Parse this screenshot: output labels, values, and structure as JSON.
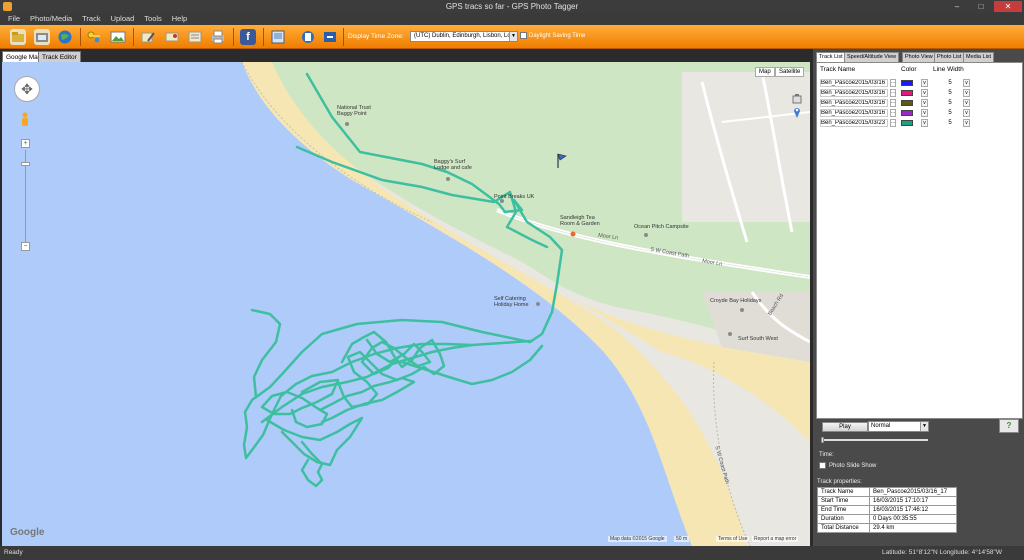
{
  "window": {
    "title": "GPS tracs so far - GPS Photo Tagger",
    "minimize_glyph": "–",
    "maximize_glyph": "□",
    "close_glyph": "✕"
  },
  "menu": [
    "File",
    "Photo/Media",
    "Track",
    "Upload",
    "Tools",
    "Help"
  ],
  "toolbar": {
    "icons": [
      "open-folder-icon",
      "import-photos-icon",
      "globe-icon",
      "key-icon",
      "photo-icon",
      "edit-icon",
      "tag-icon",
      "export-icon",
      "print-icon",
      "facebook-icon",
      "album-icon",
      "phone-icon",
      "sync-icon"
    ],
    "facebook_glyph": "f",
    "time_zone_label": "Display Time Zone:",
    "time_zone_value": "(UTC) Dublin, Edinburgh, Lisbon, Lon",
    "dst_label": "Daylight Saving Time"
  },
  "tabs": {
    "google_map": "Google Map",
    "track_editor": "Track Editor"
  },
  "map": {
    "type_map": "Map",
    "type_satellite": "Satellite",
    "zoom_in": "+",
    "zoom_out": "−",
    "pan_glyph": "✥",
    "places": {
      "national_trust": "National Trust\nBaggy Point",
      "baggys": "Baggy's Surf\nLodge and cafe",
      "point_breaks": "Point Breaks UK",
      "sandleigh": "Sandleigh Tea\nRoom & Garden",
      "ocean_pitch": "Ocean Pitch Campsite",
      "self_catering": "Self Catering\nHoliday Home",
      "croyde_bay": "Croyde Bay Holidays",
      "surf_south_west": "Surf South West"
    },
    "roads": {
      "moor_ln_1": "Moor Ln",
      "sw_coast_path_1": "S W Coast Path",
      "moor_ln_2": "Moor Ln",
      "sw_coast_path_2": "S W Coast Path",
      "beach_rd": "Beach Rd"
    },
    "google_logo": "Google",
    "attribution": "Map data ©2015 Google",
    "scale": "50 m",
    "terms": "Terms of Use",
    "report": "Report a map error",
    "track_color": "#3dbfa0"
  },
  "right_tabs": [
    "Track List",
    "Speed/Altitude View",
    "Photo View",
    "Photo List",
    "Media List"
  ],
  "track_list": {
    "headers": {
      "name": "Track Name",
      "color": "Color",
      "width": "Line Width"
    },
    "rows": [
      {
        "name": "Ben_Pascoe2015/03/16",
        "color": "#1a1aff",
        "width": "5"
      },
      {
        "name": "Ben_Pascoe2015/03/16",
        "color": "#e0197e",
        "width": "5"
      },
      {
        "name": "Ben_Pascoe2015/03/16",
        "color": "#5a5a12",
        "width": "5"
      },
      {
        "name": "Ben_Pascoe2015/03/16",
        "color": "#9b27c9",
        "width": "5"
      },
      {
        "name": "Ben_Pascoe2015/03/23",
        "color": "#18a37a",
        "width": "5"
      }
    ],
    "dots": "...",
    "dd_glyph": "v"
  },
  "playback": {
    "play_label": "Play",
    "speed": "Normal",
    "time_label": "Time:",
    "slide_show_label": "Photo Slide Show",
    "help_glyph": "?"
  },
  "properties": {
    "label": "Track properties:",
    "rows": [
      {
        "key": "Track Name",
        "value": "Ben_Pascoe2015/03/16_17"
      },
      {
        "key": "Start Time",
        "value": "16/03/2015 17:10:17"
      },
      {
        "key": "End Time",
        "value": "16/03/2015 17:46:12"
      },
      {
        "key": "Duration",
        "value": "0 Days  00:35:55"
      },
      {
        "key": "Total Distance",
        "value": "29.4 km"
      }
    ]
  },
  "status": {
    "left": "Ready",
    "coords": "Latitude:  51°8'12\"N  Longitude:  4°14'58\"W"
  }
}
